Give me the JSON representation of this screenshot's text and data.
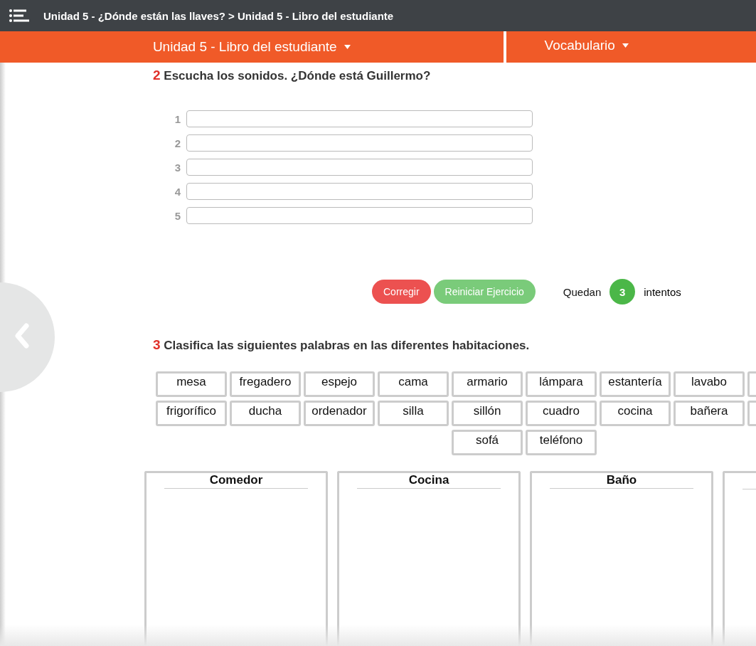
{
  "breadcrumb": "Unidad 5 - ¿Dónde están las llaves? > Unidad 5 - Libro del estudiante",
  "nav_tabs": [
    {
      "label": "Unidad 5 - Libro del estudiante"
    },
    {
      "label": "Vocabulario"
    }
  ],
  "exercise_2": {
    "number": "2",
    "instruction": "Escucha los sonidos. ¿Dónde está Guillermo?",
    "answers": [
      {
        "number": "1"
      },
      {
        "number": "2"
      },
      {
        "number": "3"
      },
      {
        "number": "4"
      },
      {
        "number": "5"
      }
    ],
    "buttons": [
      {
        "label": "Corregir",
        "kind": "check"
      },
      {
        "label": "Reiniciar Ejercicio",
        "kind": "reset"
      }
    ],
    "attempts": {
      "prefix": "Quedan",
      "count": "3",
      "suffix": "intentos"
    }
  },
  "exercise_3": {
    "number": "3",
    "instruction": "Clasifica las siguientes palabras en las diferentes habitaciones.",
    "word_rows": [
      [
        "mesa",
        "fregadero",
        "espejo",
        "cama",
        "armario",
        "lámpara",
        "estantería",
        "lavabo"
      ],
      [
        "frigorífico",
        "ducha",
        "ordenador",
        "silla",
        "sillón",
        "cuadro",
        "cocina",
        "bañera"
      ],
      [
        "sofá",
        "teléfono"
      ]
    ],
    "rooms": [
      {
        "title": "Comedor"
      },
      {
        "title": "Cocina"
      },
      {
        "title": "Baño"
      }
    ]
  }
}
